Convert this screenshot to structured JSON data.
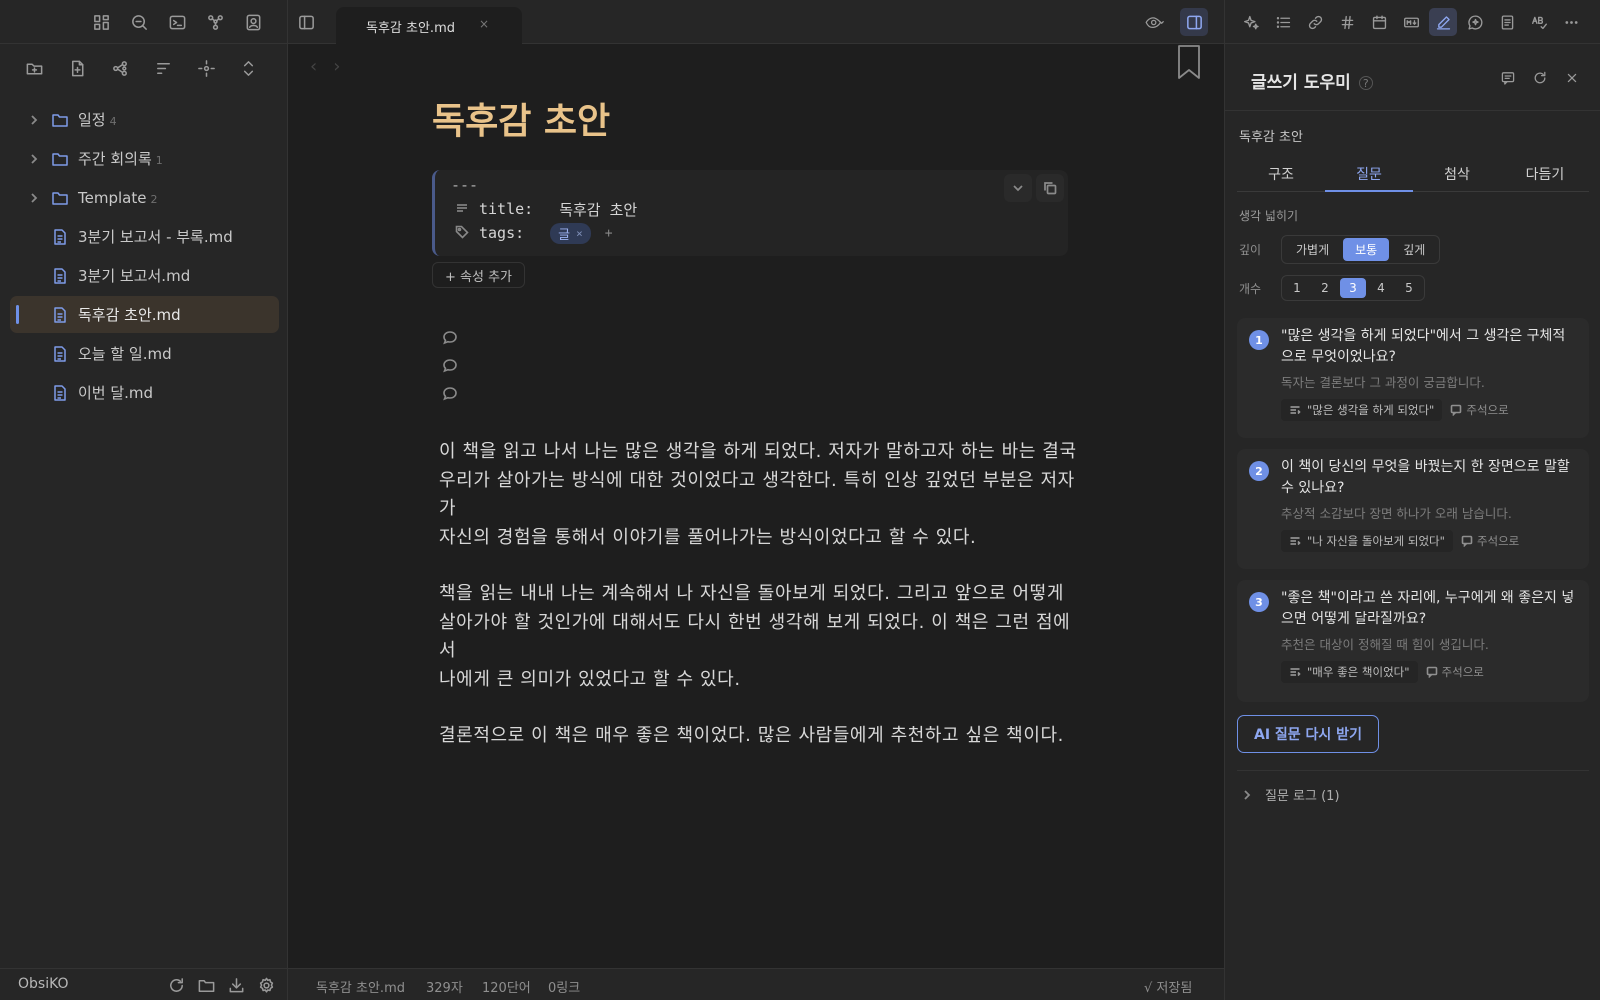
{
  "sidebar": {
    "ribbon_icons": [
      "layout-grid-icon",
      "search-icon",
      "terminal-icon",
      "graph-icon",
      "contact-icon"
    ],
    "toolbar_icons": [
      "new-folder-icon",
      "new-file-icon",
      "graph-view-icon",
      "sort-icon",
      "locate-icon",
      "collapse-icon"
    ],
    "tree": [
      {
        "label": "일정",
        "count": "4",
        "type": "folder"
      },
      {
        "label": "주간 회의록",
        "count": "1",
        "type": "folder"
      },
      {
        "label": "Template",
        "count": "2",
        "type": "folder"
      },
      {
        "label": "3분기 보고서 - 부록.md",
        "type": "file"
      },
      {
        "label": "3분기 보고서.md",
        "type": "file"
      },
      {
        "label": "독후감 초안.md",
        "type": "file",
        "active": true
      },
      {
        "label": "오늘 할 일.md",
        "type": "file"
      },
      {
        "label": "이번 달.md",
        "type": "file"
      }
    ],
    "vault_name": "ObsiKO",
    "vault_icons": [
      "refresh-icon",
      "folder-icon",
      "download-icon",
      "settings-icon"
    ]
  },
  "tabbar": {
    "tab_title": "독후감 초안.md",
    "tab_close": "×"
  },
  "editor": {
    "title": "독후감 초안",
    "frontmatter_dashes": "---",
    "props": {
      "title_key": "title:",
      "title_value": "독후감 초안",
      "tags_key": "tags:",
      "tag": "글",
      "tag_remove": "×",
      "tag_add": "+"
    },
    "add_property": "+ 속성 추가",
    "paragraphs": [
      [
        "이 책을 읽고 나서 나는 많은 생각을 하게 되었다. 저자가 말하고자 하는 바는 결국",
        "우리가 살아가는 방식에 대한 것이었다고 생각한다. 특히 인상 깊었던 부분은 저자가",
        "자신의 경험을 통해서 이야기를 풀어나가는 방식이었다고 할 수 있다."
      ],
      [
        "책을 읽는 내내 나는 계속해서 나 자신을 돌아보게 되었다. 그리고 앞으로 어떻게",
        "살아가야 할 것인가에 대해서도 다시 한번 생각해 보게 되었다. 이 책은 그런 점에서",
        "나에게 큰 의미가 있었다고 할 수 있다."
      ],
      [
        "결론적으로 이 책은 매우 좋은 책이었다. 많은 사람들에게 추천하고 싶은 책이다."
      ]
    ]
  },
  "status": {
    "file": "독후감 초안.md",
    "chars": "329자",
    "words": "120단어",
    "links": "0링크",
    "saved": "√ 저장됨"
  },
  "panel": {
    "title": "글쓰기 도우미",
    "help": "?",
    "note_name": "독후감 초안",
    "tabs": [
      "구조",
      "질문",
      "첨삭",
      "다듬기"
    ],
    "active_tab": 1,
    "section": "생각 넓히기",
    "depth_label": "깊이",
    "depth_options": [
      "가볍게",
      "보통",
      "깊게"
    ],
    "depth_selected": 1,
    "count_label": "개수",
    "count_options": [
      "1",
      "2",
      "3",
      "4",
      "5"
    ],
    "count_selected": 2,
    "questions": [
      {
        "num": "1",
        "text": "\"많은 생각을 하게 되었다\"에서 그 생각은 구체적으로 무엇이었나요?",
        "hint": "독자는 결론보다 그 과정이 궁금합니다.",
        "quote": "\"많은 생각을 하게 되었다\"",
        "memo": "주석으로"
      },
      {
        "num": "2",
        "text": "이 책이 당신의 무엇을 바꿨는지 한 장면으로 말할 수 있나요?",
        "hint": "추상적 소감보다 장면 하나가 오래 남습니다.",
        "quote": "\"나 자신을 돌아보게 되었다\"",
        "memo": "주석으로"
      },
      {
        "num": "3",
        "text": "\"좋은 책\"이라고 쓴 자리에, 누구에게 왜 좋은지 넣으면 어떻게 달라질까요?",
        "hint": "추천은 대상이 정해질 때 힘이 생깁니다.",
        "quote": "\"매우 좋은 책이었다\"",
        "memo": "주석으로"
      }
    ],
    "regen_button": "AI 질문 다시 받기",
    "log_label": "질문 로그 (1)"
  },
  "colors": {
    "accent": "#6f90e6",
    "title": "#e9c38a",
    "bg": "#1e1e1e",
    "sidebar_bg": "#262626"
  }
}
